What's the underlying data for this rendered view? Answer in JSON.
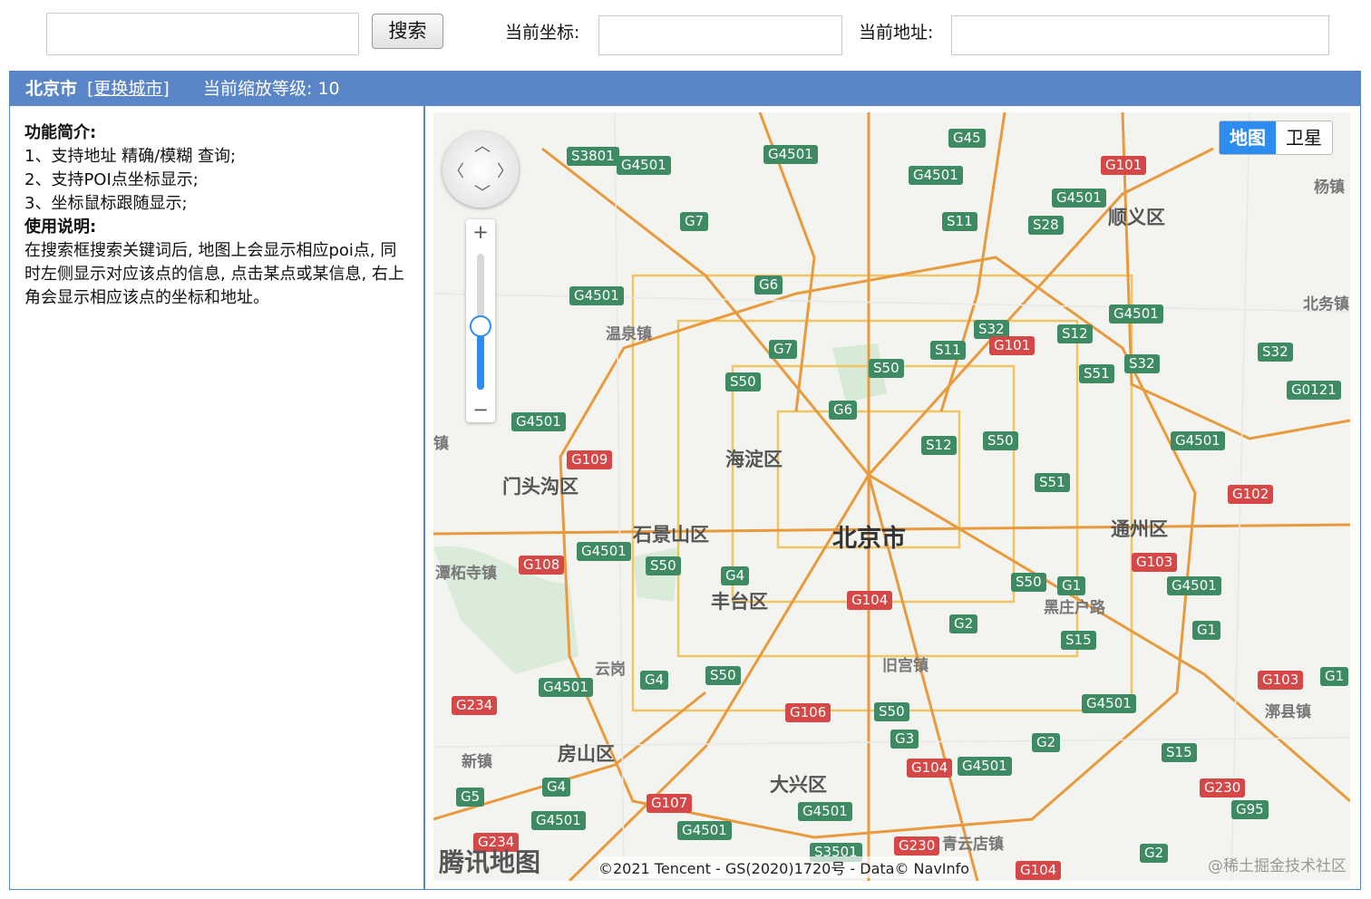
{
  "search": {
    "placeholder": "",
    "button": "搜索"
  },
  "coord": {
    "label": "当前坐标:",
    "value": ""
  },
  "address": {
    "label": "当前地址:",
    "value": ""
  },
  "header": {
    "city": "北京市",
    "change": "[更换城市]",
    "zoom": "当前缩放等级: 10"
  },
  "sidebar": {
    "intro_title": "功能简介:",
    "intro_items": [
      "1、支持地址 精确/模糊 查询;",
      "2、支持POI点坐标显示;",
      "3、坐标鼠标跟随显示;"
    ],
    "usage_title": "使用说明:",
    "usage_text": "在搜索框搜索关键词后, 地图上会显示相应poi点, 同时左侧显示对应该点的信息, 点击某点或某信息, 右上角会显示相应该点的坐标和地址。"
  },
  "map": {
    "type_map": "地图",
    "type_satellite": "卫星",
    "logo": "腾讯地图",
    "copyright": "©2021 Tencent - GS(2020)1720号 - Data© NavInfo",
    "watermark": "@稀土掘金技术社区",
    "places": {
      "center": "北京市",
      "haidian": "海淀区",
      "mentougou": "门头沟区",
      "shijingshan": "石景山区",
      "fengtai": "丰台区",
      "tongzhou": "通州区",
      "shunyi": "顺义区",
      "fangshan": "房山区",
      "daxing": "大兴区",
      "wenquan": "温泉镇",
      "tanzhesi": "潭柘寺镇",
      "yungang": "云岗",
      "jiugong": "旧宫镇",
      "heizhuanghu": "黑庄户路",
      "qingyundian": "青云店镇",
      "xinzhen": "新镇",
      "yangzhen": "杨镇",
      "beiwu": "北务镇",
      "yongledian": "漷县镇",
      "zhen": "镇"
    },
    "shields": {
      "s3801": "S3801",
      "g4501": "G4501",
      "g45": "G45",
      "g101": "G101",
      "s11": "S11",
      "s28": "S28",
      "g7": "G7",
      "g6": "G6",
      "s32": "S32",
      "s12": "S12",
      "s51": "S51",
      "s50": "S50",
      "g0121": "G0121",
      "g109": "G109",
      "g102": "G102",
      "g108": "G108",
      "g4": "G4",
      "g104": "G104",
      "g1": "G1",
      "g103": "G103",
      "g2": "G2",
      "s15": "S15",
      "g234": "G234",
      "g106": "G106",
      "g3": "G3",
      "g230": "G230",
      "g95": "G95",
      "g5": "G5",
      "g107": "G107",
      "s3501": "S3501"
    }
  }
}
